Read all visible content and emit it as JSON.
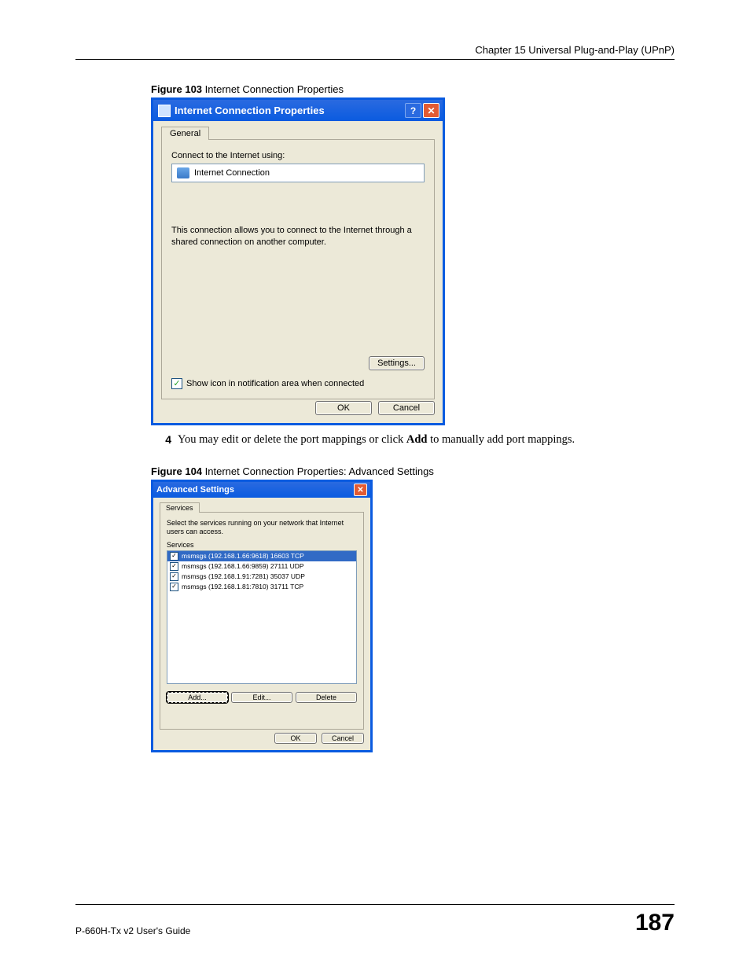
{
  "header": {
    "chapter": "Chapter 15 Universal Plug-and-Play (UPnP)"
  },
  "figure103": {
    "caption_bold": "Figure 103",
    "caption_text": "   Internet Connection Properties",
    "title": "Internet Connection Properties",
    "help_glyph": "?",
    "close_glyph": "✕",
    "tab": "General",
    "connect_label": "Connect to the Internet using:",
    "connection_name": "Internet Connection",
    "description": "This connection allows you to connect to the Internet through a shared connection on another computer.",
    "settings_button": "Settings...",
    "checkbox_checked": "✓",
    "checkbox_label": "Show icon in notification area when connected",
    "ok": "OK",
    "cancel": "Cancel"
  },
  "step": {
    "num": "4",
    "text_before": "You may edit or delete the port mappings or click ",
    "bold": "Add",
    "text_after": " to manually add port mappings."
  },
  "figure104": {
    "caption_bold": "Figure 104",
    "caption_text": "   Internet Connection Properties: Advanced Settings",
    "title": "Advanced Settings",
    "close_glyph": "✕",
    "tab": "Services",
    "instructions": "Select the services running on your network that Internet users can access.",
    "services_label": "Services",
    "services": [
      {
        "checked": "✓",
        "selected": true,
        "text": "msmsgs (192.168.1.66:9618) 16603 TCP"
      },
      {
        "checked": "✓",
        "selected": false,
        "text": "msmsgs (192.168.1.66:9859) 27111 UDP"
      },
      {
        "checked": "✓",
        "selected": false,
        "text": "msmsgs (192.168.1.91:7281) 35037 UDP"
      },
      {
        "checked": "✓",
        "selected": false,
        "text": "msmsgs (192.168.1.81:7810) 31711 TCP"
      }
    ],
    "add": "Add...",
    "edit": "Edit...",
    "delete": "Delete",
    "ok": "OK",
    "cancel": "Cancel"
  },
  "footer": {
    "guide": "P-660H-Tx v2 User's Guide",
    "page": "187"
  }
}
